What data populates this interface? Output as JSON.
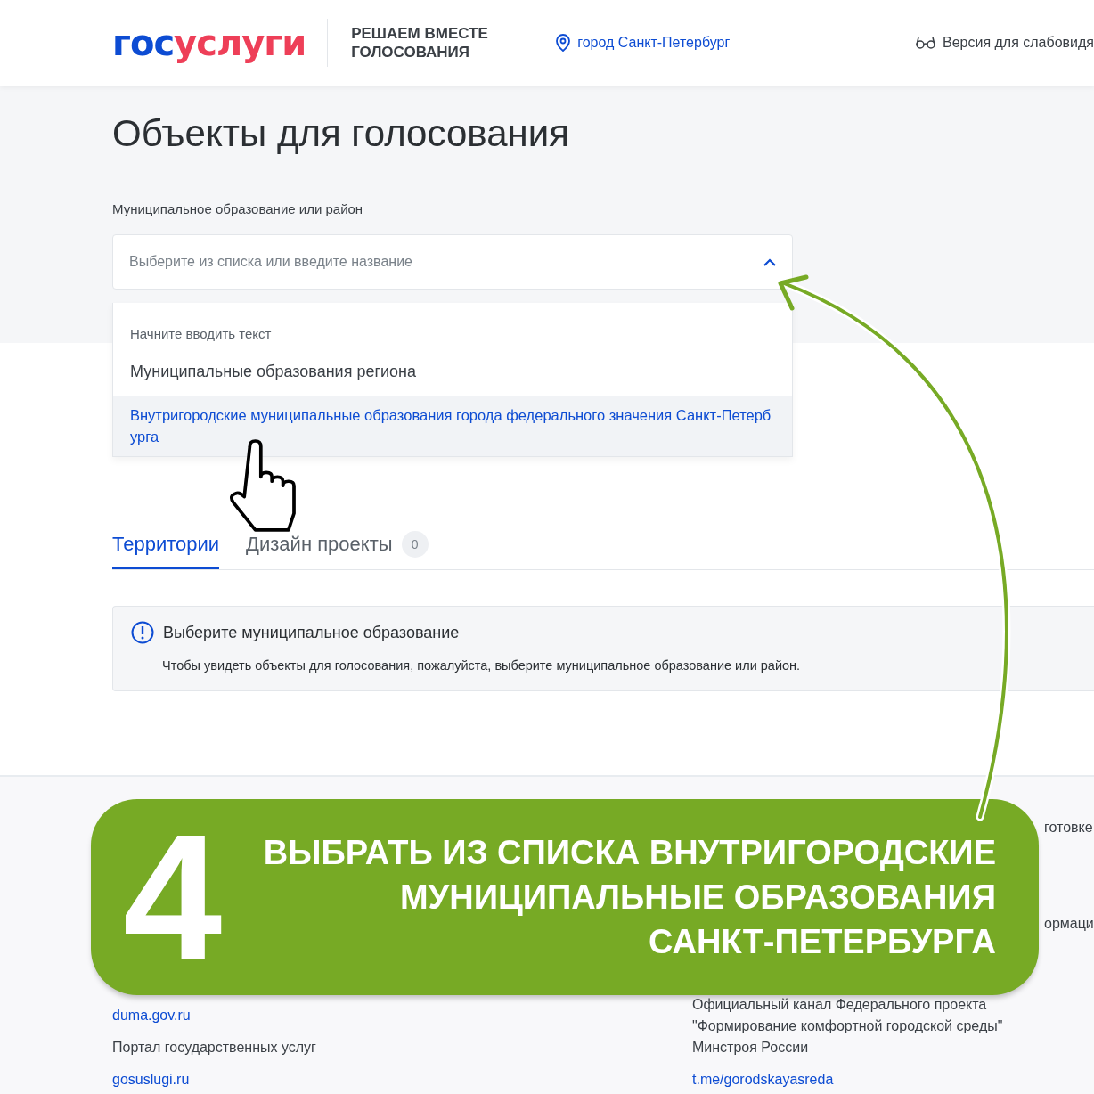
{
  "header": {
    "logo": {
      "part1": "гос",
      "part2": "услуги"
    },
    "tagline": "РЕШАЕМ ВМЕСТЕ ГОЛОСОВАНИЯ",
    "location": "город Санкт-Петербург",
    "accessibility": "Версия для слабовидя"
  },
  "page": {
    "title": "Объекты для голосования",
    "field_label": "Муниципальное образование или район",
    "select": {
      "placeholder": "Выберите из списка или введите название",
      "expanded": true
    },
    "dropdown": {
      "hint": "Начните вводить текст",
      "group": "Муниципальные образования региона",
      "options": [
        {
          "label": "Внутригородские муниципальные образования города федерального значения Санкт-Петербурга",
          "selected": true
        }
      ]
    }
  },
  "tabs": [
    {
      "label": "Территории",
      "selected": true
    },
    {
      "label": "Дизайн проекты",
      "count": "0",
      "selected": false
    }
  ],
  "notice": {
    "title": "Выберите муниципальное образование",
    "text": "Чтобы увидеть объекты для голосования, пожалуйста, выберите муниципальное образование или район."
  },
  "footer": {
    "left": [
      {
        "kind": "link",
        "text": "duma.gov.ru"
      },
      {
        "kind": "text",
        "text": "Портал государственных услуг"
      },
      {
        "kind": "link",
        "text": "gosuslugi.ru"
      }
    ],
    "right": [
      {
        "kind": "text",
        "text": "Официальный канал Федерального проекта"
      },
      {
        "kind": "text",
        "text": "\"Формирование комфортной городской среды\""
      },
      {
        "kind": "text",
        "text": "Минстроя России"
      },
      {
        "kind": "link",
        "text": "t.me/gorodskayasreda"
      }
    ],
    "edge": [
      "готовке",
      "ормаци"
    ]
  },
  "banner": {
    "step": "4",
    "lines": [
      "ВЫБРАТЬ ИЗ СПИСКА ВНУТРИГОРОДСКИЕ",
      "МУНИЦИПАЛЬНЫЕ ОБРАЗОВАНИЯ",
      "САНКТ-ПЕТЕРБУРГА"
    ]
  }
}
